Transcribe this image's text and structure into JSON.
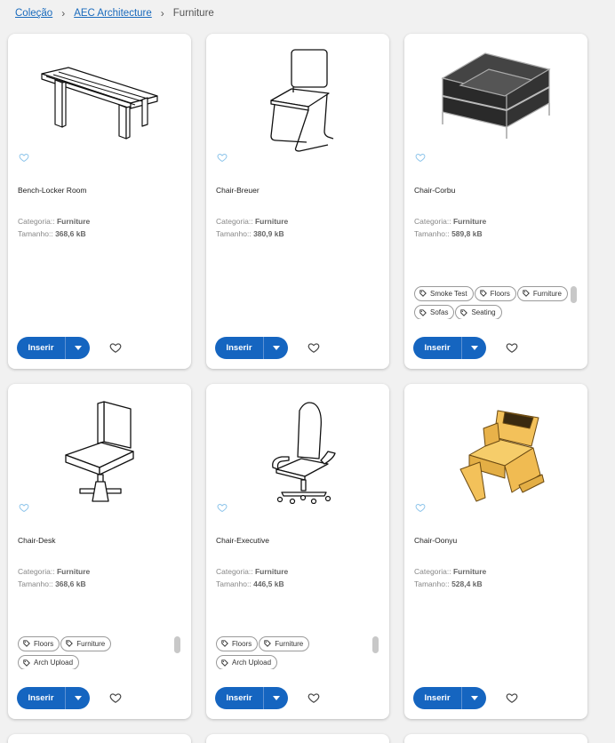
{
  "breadcrumb": {
    "items": [
      "Coleção",
      "AEC Architecture"
    ],
    "current": "Furniture"
  },
  "labels": {
    "category": "Categoria::",
    "size": "Tamanho::",
    "insert": "Inserir"
  },
  "colors": {
    "accent": "#1565c0",
    "link": "#1a6bbd",
    "favorite_light": "#8cc4ea"
  },
  "cards": [
    {
      "title": "Bench-Locker Room",
      "category": "Furniture",
      "size": "368,6 kB",
      "tags": []
    },
    {
      "title": "Chair-Breuer",
      "category": "Furniture",
      "size": "380,9 kB",
      "tags": []
    },
    {
      "title": "Chair-Corbu",
      "category": "Furniture",
      "size": "589,8 kB",
      "tags": [
        "Smoke Test",
        "Floors",
        "Furniture",
        "Sofas",
        "Seating"
      ]
    },
    {
      "title": "Chair-Desk",
      "category": "Furniture",
      "size": "368,6 kB",
      "tags": [
        "Floors",
        "Furniture",
        "Arch Upload"
      ]
    },
    {
      "title": "Chair-Executive",
      "category": "Furniture",
      "size": "446,5 kB",
      "tags": [
        "Floors",
        "Furniture",
        "Arch Upload"
      ]
    },
    {
      "title": "Chair-Oonyu",
      "category": "Furniture",
      "size": "528,4 kB",
      "tags": []
    }
  ]
}
